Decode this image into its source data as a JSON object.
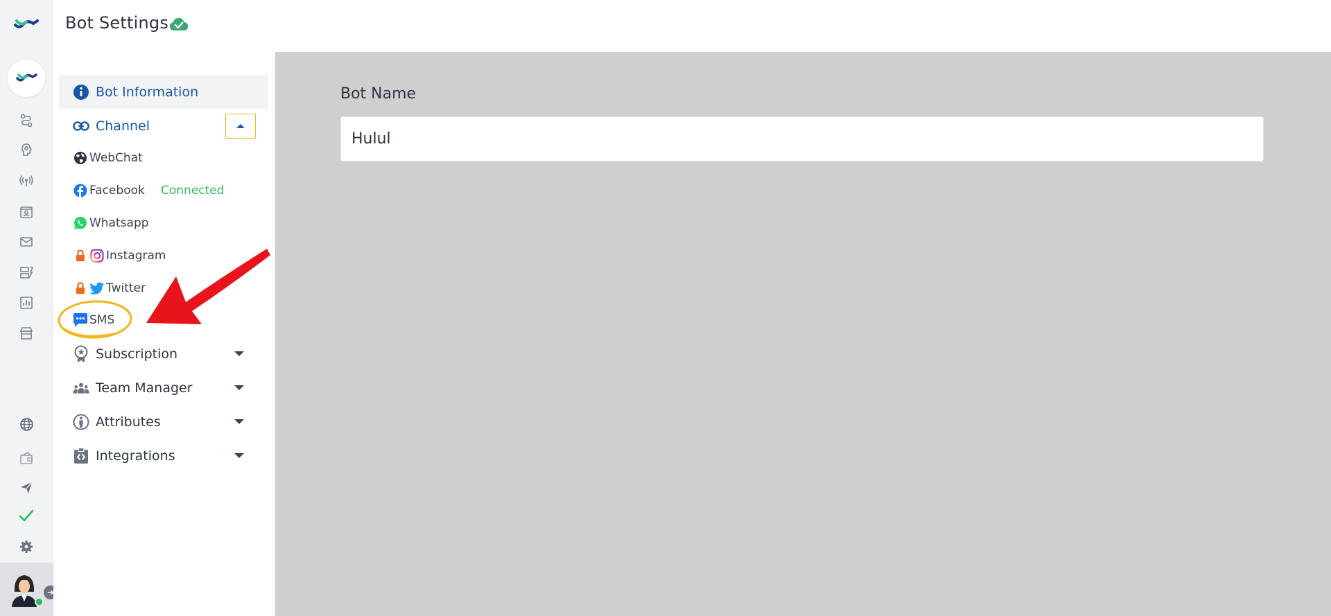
{
  "header": {
    "title": "Bot Settings",
    "status_icon": "cloud-check-icon"
  },
  "rail": {
    "top_icons": [
      "flow-icon",
      "brain-icon",
      "broadcast-icon",
      "contacts-icon",
      "mail-icon",
      "board-icon",
      "analytics-icon",
      "store-icon"
    ],
    "bottom_icons": [
      "globe-icon",
      "wallet-icon",
      "send-icon",
      "check-icon",
      "settings-icon"
    ]
  },
  "nav": {
    "items": [
      {
        "label": "Bot Information",
        "icon": "info-icon"
      },
      {
        "label": "Channel",
        "icon": "link-icon"
      },
      {
        "label": "Subscription",
        "icon": "award-icon"
      },
      {
        "label": "Team Manager",
        "icon": "team-icon"
      },
      {
        "label": "Attributes",
        "icon": "person-icon"
      },
      {
        "label": "Integrations",
        "icon": "code-clipboard-icon"
      }
    ],
    "channels": [
      {
        "label": "WebChat",
        "icon": "globe-icon"
      },
      {
        "label": "Facebook",
        "icon": "facebook-icon",
        "status": "Connected"
      },
      {
        "label": "Whatsapp",
        "icon": "whatsapp-icon"
      },
      {
        "label": "Instagram",
        "icon": "instagram-icon",
        "locked": true
      },
      {
        "label": "Twitter",
        "icon": "twitter-icon",
        "locked": true
      },
      {
        "label": "SMS",
        "icon": "sms-icon"
      }
    ]
  },
  "main": {
    "field_label": "Bot Name",
    "field_value": "Hulul"
  },
  "colors": {
    "accent_blue": "#1a56a5",
    "green": "#2dbb54",
    "highlight_yellow": "#f3b41c",
    "annotation_red": "#e8141b",
    "panel_gray": "#cfcfcf"
  }
}
